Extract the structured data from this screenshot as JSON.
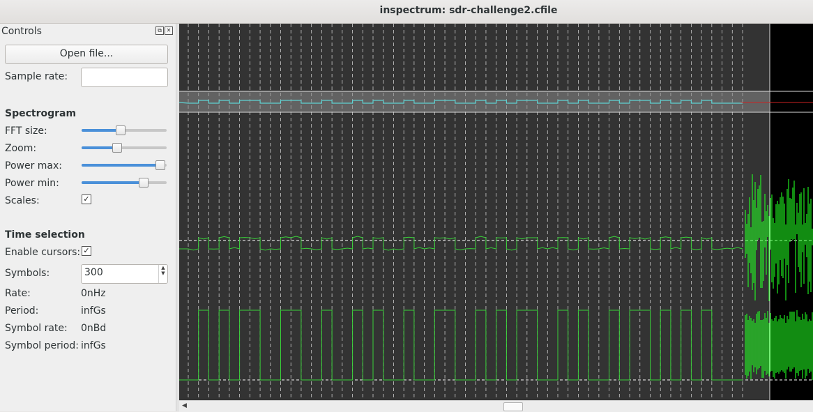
{
  "window": {
    "title": "inspectrum: sdr-challenge2.cfile"
  },
  "dock": {
    "title": "Controls",
    "open_file_label": "Open file...",
    "sample_rate_label": "Sample rate:",
    "sample_rate_value": "",
    "spectrogram_heading": "Spectrogram",
    "fft_size_label": "FFT size:",
    "zoom_label": "Zoom:",
    "power_max_label": "Power max:",
    "power_min_label": "Power min:",
    "scales_label": "Scales:",
    "time_selection_heading": "Time selection",
    "enable_cursors_label": "Enable cursors:",
    "symbols_label": "Symbols:",
    "symbols_value": "300",
    "rate_label": "Rate:",
    "rate_value": "0nHz",
    "period_label": "Period:",
    "period_value": "infGs",
    "symbol_rate_label": "Symbol rate:",
    "symbol_rate_value": "0nBd",
    "symbol_period_label": "Symbol period:",
    "symbol_period_value": "infGs"
  },
  "sliders": {
    "fft_size": 0.45,
    "zoom": 0.41,
    "power_max": 0.92,
    "power_min": 0.72
  },
  "checks": {
    "scales": true,
    "enable_cursors": true
  },
  "signal": {
    "bits": [
      0,
      1,
      0,
      1,
      0,
      1,
      1,
      0,
      0,
      1,
      1,
      0,
      0,
      1,
      0,
      0,
      1,
      0,
      1,
      0,
      0,
      1,
      0,
      0,
      1,
      1,
      0,
      0,
      1,
      0,
      1,
      0,
      1,
      1,
      0,
      0,
      1,
      0,
      1,
      0,
      0,
      1,
      0,
      1,
      1,
      0,
      1,
      0,
      1,
      0,
      1,
      0,
      0,
      0
    ],
    "colors": {
      "trace": "#39d139",
      "noise": "#22ff22",
      "grid": "#ffffff",
      "background": "#333333",
      "tail": "#000000",
      "marker": "#cc2222"
    }
  },
  "icons": {
    "float": "float-icon",
    "close": "close-icon",
    "scroll_left": "left-arrow-icon"
  }
}
